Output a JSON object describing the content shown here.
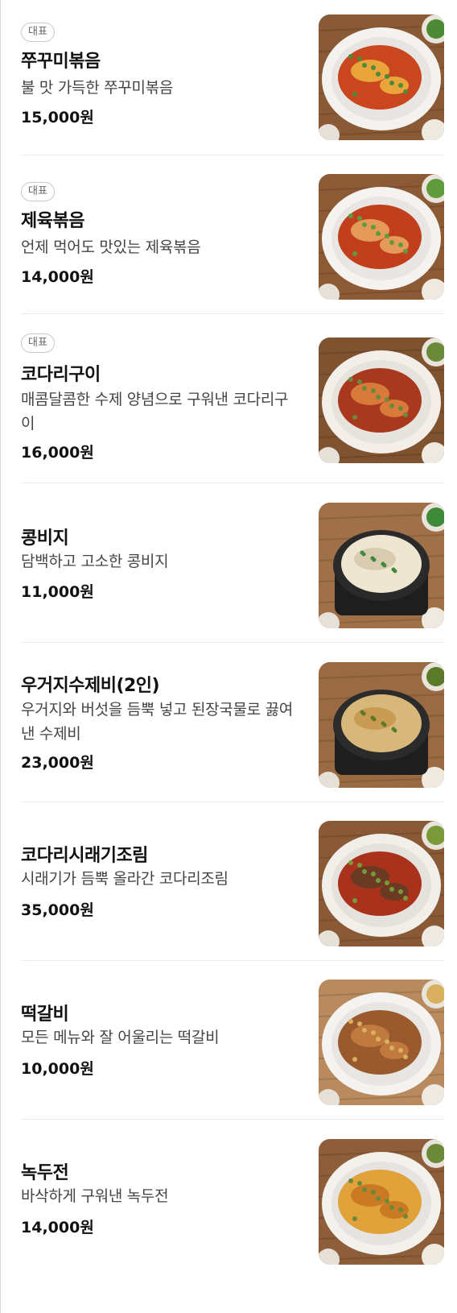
{
  "menu": {
    "items": [
      {
        "badge": "대표",
        "name": "쭈꾸미볶음",
        "desc": "불 맛 가득한 쭈꾸미볶음",
        "price": "15,000원",
        "photo_icon": "jjukkumi-dish-photo",
        "colors": {
          "bg": "#8a5a36",
          "plate": "#f4f2ee",
          "food": "#c9461f",
          "food2": "#e9a43a",
          "garnish": "#4d8a36"
        }
      },
      {
        "badge": "대표",
        "name": "제육볶음",
        "desc": "언제 먹어도 맛있는 제육볶음",
        "price": "14,000원",
        "photo_icon": "jeyuk-dish-photo",
        "colors": {
          "bg": "#8c5a34",
          "plate": "#f5f3ef",
          "food": "#c23f1e",
          "food2": "#e69a5a",
          "garnish": "#5f9a3c"
        }
      },
      {
        "badge": "대표",
        "name": "코다리구이",
        "desc": "매콤달콤한 수제 양념으로 구워낸 코다리구이",
        "price": "16,000원",
        "photo_icon": "kodari-grill-photo",
        "colors": {
          "bg": "#7f5230",
          "plate": "#f3efe8",
          "food": "#a8381e",
          "food2": "#d87a3a",
          "garnish": "#6a8a3a"
        }
      },
      {
        "badge": "",
        "name": "콩비지",
        "desc": "담백하고 고소한 콩비지",
        "price": "11,000원",
        "photo_icon": "kongbiji-stew-photo",
        "colors": {
          "bg": "#a07048",
          "plate": "#2a2a2a",
          "food": "#efe6d2",
          "food2": "#d9cbb0",
          "garnish": "#3f8a3a"
        }
      },
      {
        "badge": "",
        "name": "우거지수제비(2인)",
        "desc": "우거지와 버섯을 듬뿍 넣고 된장국물로 끓여낸 수제비",
        "price": "23,000원",
        "photo_icon": "sujebi-pot-photo",
        "colors": {
          "bg": "#9a6a42",
          "plate": "#2b2b2b",
          "food": "#d8b87a",
          "food2": "#c99a52",
          "garnish": "#5a7a2a"
        }
      },
      {
        "badge": "",
        "name": "코다리시래기조림",
        "desc": "시래기가 듬뿍 올라간 코다리조림",
        "price": "35,000원",
        "photo_icon": "kodari-jorim-photo",
        "colors": {
          "bg": "#8a5a36",
          "plate": "#f2efea",
          "food": "#a8321c",
          "food2": "#6a3a22",
          "garnish": "#7a9a3a"
        }
      },
      {
        "badge": "",
        "name": "떡갈비",
        "desc": "모든 메뉴와 잘 어울리는 떡갈비",
        "price": "10,000원",
        "photo_icon": "tteokgalbi-plate-photo",
        "colors": {
          "bg": "#b88a5e",
          "plate": "#f5f3ef",
          "food": "#9a5a2e",
          "food2": "#c07a3e",
          "garnish": "#d8b060"
        }
      },
      {
        "badge": "",
        "name": "녹두전",
        "desc": "바삭하게 구워낸 녹두전",
        "price": "14,000원",
        "photo_icon": "nokdujeon-plate-photo",
        "colors": {
          "bg": "#8e5e3a",
          "plate": "#f3f1ec",
          "food": "#e2a23a",
          "food2": "#c97a22",
          "garnish": "#6a8a3a"
        }
      }
    ]
  }
}
